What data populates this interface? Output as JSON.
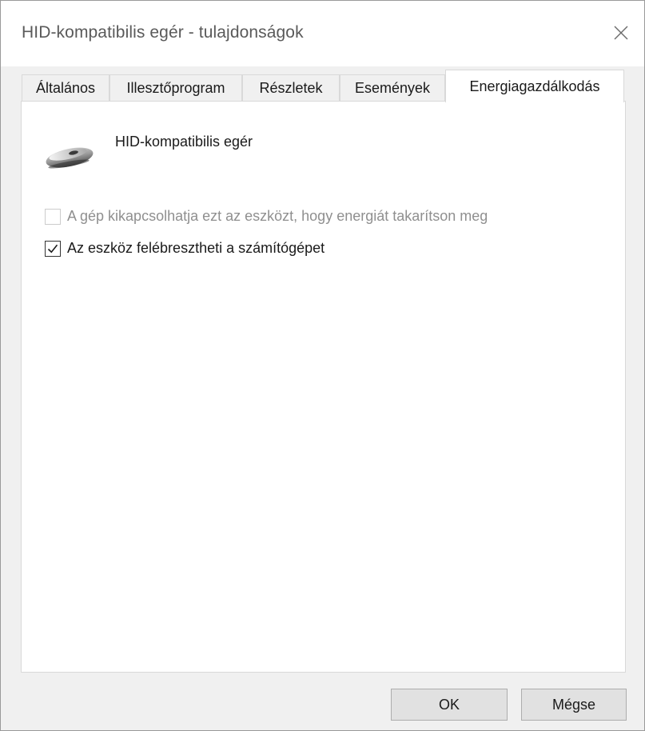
{
  "window": {
    "title": "HID-kompatibilis egér - tulajdonságok"
  },
  "tabs": [
    {
      "label": "Általános",
      "active": false
    },
    {
      "label": "Illesztőprogram",
      "active": false
    },
    {
      "label": "Részletek",
      "active": false
    },
    {
      "label": "Események",
      "active": false
    },
    {
      "label": "Energiagazdálkodás",
      "active": true
    }
  ],
  "device": {
    "icon": "mouse-icon",
    "name": "HID-kompatibilis egér"
  },
  "options": [
    {
      "label": "A gép kikapcsolhatja ezt az eszközt, hogy energiát takarítson meg",
      "checked": false,
      "enabled": false
    },
    {
      "label": "Az eszköz felébresztheti a számítógépet",
      "checked": true,
      "enabled": true
    }
  ],
  "buttons": {
    "ok_label": "OK",
    "cancel_label": "Mégse"
  },
  "icons": {
    "close": "close-icon",
    "checkmark": "checkmark-icon"
  }
}
